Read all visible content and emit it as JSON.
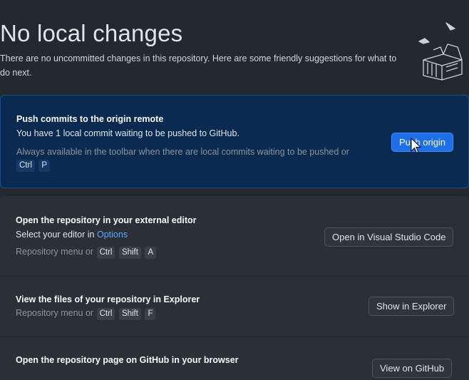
{
  "header": {
    "title": "No local changes",
    "description": "There are no uncommitted changes in this repository. Here are some friendly suggestions for what to do next."
  },
  "push_card": {
    "title": "Push commits to the origin remote",
    "subtitle": "You have 1 local commit waiting to be pushed to GitHub.",
    "hint": "Always available in the toolbar when there are local commits waiting to be pushed or",
    "shortcut_keys": [
      "Ctrl",
      "P"
    ],
    "button_label": "Push origin"
  },
  "editor_card": {
    "title": "Open the repository in your external editor",
    "subtitle_prefix": "Select your editor in",
    "subtitle_link": "Options",
    "hint_prefix": "Repository menu or",
    "shortcut_keys": [
      "Ctrl",
      "Shift",
      "A"
    ],
    "button_label": "Open in Visual Studio Code"
  },
  "explorer_card": {
    "title": "View the files of your repository in Explorer",
    "hint_prefix": "Repository menu or",
    "shortcut_keys": [
      "Ctrl",
      "Shift",
      "F"
    ],
    "button_label": "Show in Explorer"
  },
  "github_card": {
    "title": "Open the repository page on GitHub in your browser",
    "button_label": "View on GitHub"
  },
  "colors": {
    "background": "#24292e",
    "push_card_bg": "#0b2a4f",
    "primary_button": "#1f6feb",
    "link": "#58a6ff"
  },
  "icons": [
    "empty-box-illustration",
    "mouse-cursor-icon"
  ]
}
